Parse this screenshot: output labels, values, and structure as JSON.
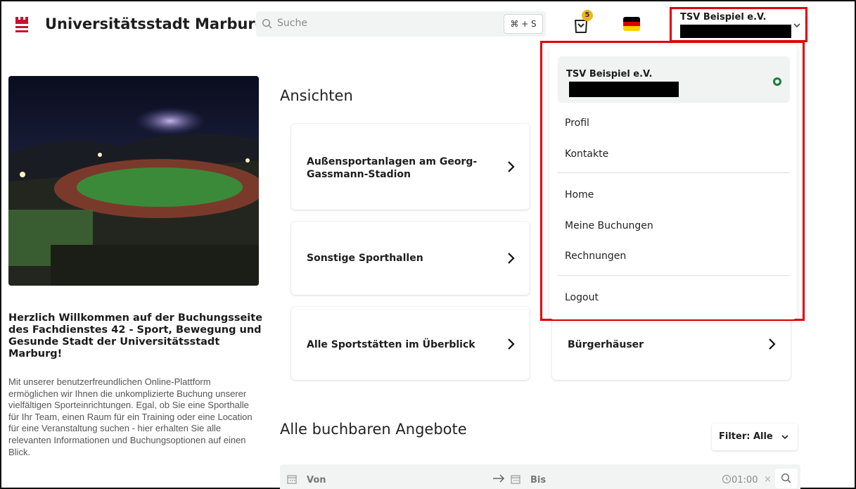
{
  "header": {
    "brand": "Universitätsstadt Marburg",
    "search_placeholder": "Suche",
    "shortcut": "⌘ + S",
    "cart_count": "5",
    "language_flag": "german-flag",
    "user": {
      "name": "TSV Beispiel e.V."
    }
  },
  "intro": {
    "title": "Herzlich Willkommen auf der Buchungsseite des Fachdienstes 42 - Sport, Bewegung und Gesunde Stadt der Universitätsstadt Marburg!",
    "body": "Mit unserer benutzerfreundlichen Online-Plattform ermöglichen wir Ihnen die unkomplizierte Buchung unserer vielfältigen Sporteinrichtungen. Egal, ob Sie eine Sporthalle für Ihr Team, einen Raum für ein Training oder eine Location für eine Veranstaltung suchen - hier erhalten Sie alle relevanten Informationen und Buchungsoptionen auf einen Blick."
  },
  "views": {
    "heading": "Ansichten",
    "cards": [
      {
        "label": "Außensportanlagen am Georg-Gassmann-Stadion"
      },
      {
        "label": "Sonstige Sporthallen"
      },
      {
        "label": "Alle Sportstätten im Überblick"
      },
      {
        "label": "Bürgerhäuser"
      }
    ]
  },
  "offers": {
    "heading": "Alle buchbaren Angebote",
    "filter_label": "Filter: Alle",
    "from_label": "Von",
    "to_label": "Bis",
    "duration": "01:00",
    "clear": "×"
  },
  "dropdown": {
    "account_name": "TSV Beispiel e.V.",
    "items_group1": [
      "Profil",
      "Kontakte"
    ],
    "items_group2": [
      "Home",
      "Meine Buchungen",
      "Rechnungen"
    ],
    "logout": "Logout"
  },
  "colors": {
    "brand_red": "#c8102e",
    "highlight_red": "#e00000",
    "active_green": "#1a7f3c",
    "badge_yellow": "#f2b51c"
  }
}
